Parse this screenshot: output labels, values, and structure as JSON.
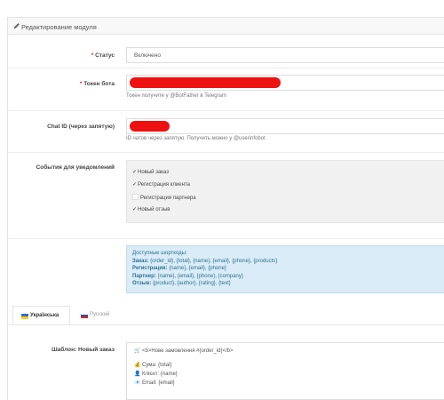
{
  "header": {
    "title": "Редактирование модуля",
    "icon": "pencil-icon"
  },
  "fields": {
    "status": {
      "label": "Статус",
      "required_mark": "*",
      "value": "Включено"
    },
    "token": {
      "label": "Токен бота",
      "required_mark": "*",
      "help": "Токен получите у @BotFather в Telegram"
    },
    "chat_id": {
      "label": "Chat ID (через запятую)",
      "help": "ID чатов через запятую. Получить можно у @userinfobot"
    },
    "events": {
      "label": "События для уведомлений",
      "options": [
        {
          "label": "Новый заказ",
          "checked": true
        },
        {
          "label": "Регистрация клиента",
          "checked": true
        },
        {
          "label": "Регистрация партнера",
          "checked": false
        },
        {
          "label": "Новый отзыв",
          "checked": true
        }
      ]
    }
  },
  "shortcodes": {
    "title": "Доступные шорткоды:",
    "lines": [
      {
        "key": "Заказ:",
        "text": " {order_id}, {total}, {name}, {email}, {phone}, {products}"
      },
      {
        "key": "Регистрация:",
        "text": " {name}, {email}, {phone}"
      },
      {
        "key": "Партнер:",
        "text": " {name}, {email}, {phone}, {company}"
      },
      {
        "key": "Отзыв:",
        "text": " {product}, {author}, {rating}, {text}"
      }
    ]
  },
  "tabs": [
    {
      "label": "Українська",
      "active": true
    },
    {
      "label": "Русский",
      "active": false
    }
  ],
  "template": {
    "label": "Шаблон: Новый заказ",
    "lines": [
      {
        "icon": "shopping-cart-icon",
        "text": "<b>Нове замовлення #{order_id}</b>"
      },
      {
        "icon": "money-bag-icon",
        "text": "Сума: {total}"
      },
      {
        "icon": "user-icon",
        "text": "Клієнт: {name}"
      },
      {
        "icon": "email-icon",
        "text": "Email: {email}"
      }
    ]
  },
  "colors": {
    "required": "#e31d1d",
    "redaction": "#ee1111",
    "info_bg": "#d9ecf7",
    "info_text": "#31708f"
  }
}
